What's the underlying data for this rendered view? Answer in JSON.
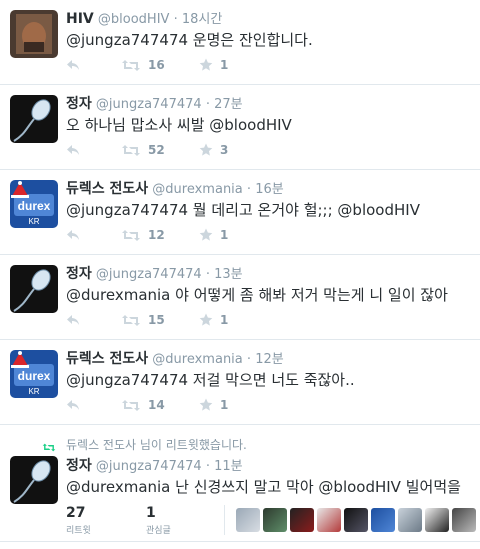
{
  "tweets": [
    {
      "name": "HIV",
      "handle": "@bloodHIV",
      "time": "18시간",
      "text": "@jungza747474 운명은 잔인합니다.",
      "retweets": "16",
      "favorites": "1",
      "avatar": "dark-photo-avatar"
    },
    {
      "name": "정자",
      "handle": "@jungza747474",
      "time": "27분",
      "text": "오 하나님 맙소사 씨발 @bloodHIV",
      "retweets": "52",
      "favorites": "3",
      "avatar": "sperm-avatar"
    },
    {
      "name": "듀렉스 전도사",
      "handle": "@durexmania",
      "time": "16분",
      "text": "@jungza747474 뭘 데리고 온거야 헐;;; @bloodHIV",
      "retweets": "12",
      "favorites": "1",
      "avatar": "durex-kr-avatar"
    },
    {
      "name": "정자",
      "handle": "@jungza747474",
      "time": "13분",
      "text": "@durexmania 야 어떻게 좀 해봐 저거 막는게 니 일이 잖아",
      "retweets": "15",
      "favorites": "1",
      "avatar": "sperm-avatar"
    },
    {
      "name": "듀렉스 전도사",
      "handle": "@durexmania",
      "time": "12분",
      "text": "@jungza747474 저걸 막으면 너도 죽잖아..",
      "retweets": "14",
      "favorites": "1",
      "avatar": "durex-kr-avatar"
    }
  ],
  "final": {
    "retweeted_by": "듀렉스 전도사 님이 리트윗했습니다.",
    "name": "정자",
    "handle": "@jungza747474",
    "time": "11분",
    "text": "@durexmania 난 신경쓰지 말고 막아 @bloodHIV 빌어먹을",
    "retweets": "27",
    "retweets_label": "리트윗",
    "favorites": "1",
    "favorites_label": "관심글"
  },
  "colors": {
    "meta": "#8899a6",
    "text": "#292f33",
    "retweet_green": "#19cf86",
    "divider": "#e1e8ed"
  },
  "icons": {
    "reply": "reply-icon",
    "retweet": "retweet-icon",
    "favorite": "star-icon",
    "time_sep": "·"
  }
}
